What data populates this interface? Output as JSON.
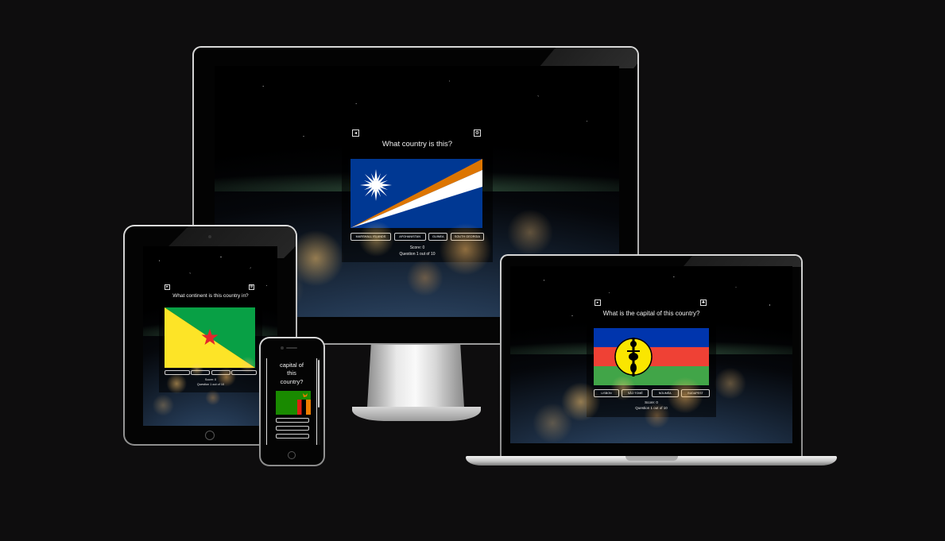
{
  "desktop": {
    "question": "What country is this?",
    "answers": [
      "MARSHALL ISLANDS",
      "AFGHANISTAN",
      "GUINEA",
      "SOUTH GEORGIA"
    ],
    "score": "Score: 0",
    "progress": "Question 1 out of 10"
  },
  "tablet": {
    "question": "What continent is this country in?",
    "score": "Score: 0",
    "progress": "Question 1 out of 10"
  },
  "laptop": {
    "question": "What is the capital of this country?",
    "answers": [
      "LISBON",
      "SÃO TOMÉ",
      "NOUMÉA",
      "BUDAPEST"
    ],
    "score": "Score: 0",
    "progress": "Question 1 out of 10"
  },
  "phone": {
    "question_lines": [
      "capital of",
      "this",
      "country?"
    ]
  },
  "icons": {
    "left_button": "arrow-icon",
    "right_button": "gear-icon"
  },
  "colors": {
    "background": "#0e0d0e",
    "marshall_blue": "#003893",
    "marshall_orange": "#dd7500",
    "guiana_green": "#08a045",
    "guiana_yellow": "#fde427",
    "guiana_star": "#e4262c",
    "caledonia_blue": "#0035ad",
    "caledonia_red": "#ef4135",
    "caledonia_green": "#41a548",
    "zambia_green": "#198a00"
  }
}
